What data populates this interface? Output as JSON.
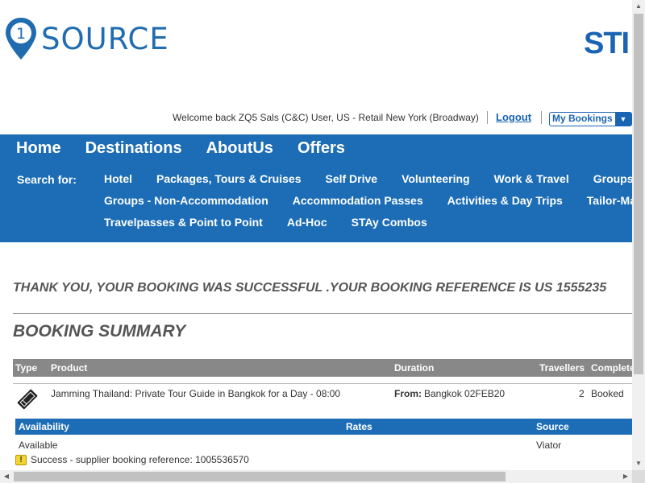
{
  "header": {
    "logo_text": "SOURCE",
    "logo_number": "1",
    "partner_logo": "STI"
  },
  "userbar": {
    "welcome": "Welcome back ZQ5 Sals (C&C) User, US - Retail New York (Broadway)",
    "logout": "Logout",
    "my_bookings": "My Bookings"
  },
  "nav": {
    "main": [
      "Home",
      "Destinations",
      "AboutUs",
      "Offers"
    ],
    "search_for": "Search for:",
    "sub_row1": [
      "Hotel",
      "Packages, Tours & Cruises",
      "Self Drive",
      "Volunteering",
      "Work & Travel",
      "Groups - Ac"
    ],
    "sub_row2": [
      "Groups - Non-Accommodation",
      "Accommodation Passes",
      "Activities & Day Trips",
      "Tailor-Made"
    ],
    "sub_row3": [
      "Travelpasses & Point to Point",
      "Ad-Hoc",
      "STAy Combos"
    ]
  },
  "content": {
    "thank_you": "THANK YOU, YOUR BOOKING WAS SUCCESSFUL .YOUR BOOKING REFERENCE IS US 1555235",
    "summary_title": "BOOKING SUMMARY",
    "table_headers": {
      "type": "Type",
      "product": "Product",
      "duration": "Duration",
      "travellers": "Travellers",
      "completed": "Complete"
    },
    "booking": {
      "product": "Jamming Thailand: Private Tour Guide in Bangkok for a Day - 08:00",
      "duration_label": "From:",
      "duration_value": "Bangkok 02FEB20",
      "travellers": "2",
      "status": "Booked"
    },
    "sub_headers": {
      "availability": "Availability",
      "rates": "Rates",
      "source": "Source"
    },
    "sub_row": {
      "availability": "Available",
      "source": "Viator"
    },
    "success_msg": "Success - supplier booking reference: 1005536570"
  },
  "colors": {
    "brand_blue": "#1c6db6",
    "header_gray": "#888888"
  },
  "icons": {
    "logo": "map-pin-icon",
    "product_type": "ticket-icon",
    "success": "warning-icon"
  }
}
